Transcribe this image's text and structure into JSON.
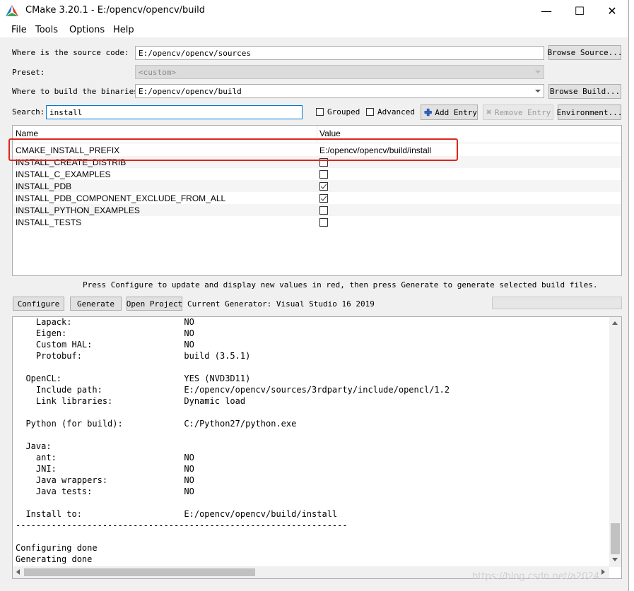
{
  "window": {
    "title": "CMake 3.20.1 - E:/opencv/opencv/build",
    "controls": {
      "minimize": "—",
      "maximize": "☐",
      "close": "✕"
    }
  },
  "menu": {
    "file": "File",
    "tools": "Tools",
    "options": "Options",
    "help": "Help"
  },
  "form": {
    "source_label": "Where is the source code:",
    "source_value": "E:/opencv/opencv/sources",
    "browse_source": "Browse Source...",
    "preset_label": "Preset:",
    "preset_value": "<custom>",
    "build_label": "Where to build the binaries:",
    "build_value": "E:/opencv/opencv/build",
    "browse_build": "Browse Build...",
    "search_label": "Search:",
    "search_value": "install",
    "grouped_label": "Grouped",
    "advanced_label": "Advanced",
    "add_entry": "Add Entry",
    "remove_entry": "Remove Entry",
    "environment": "Environment..."
  },
  "table": {
    "headers": {
      "name": "Name",
      "value": "Value"
    },
    "rows": [
      {
        "name": "CMAKE_INSTALL_PREFIX",
        "value": "E:/opencv/opencv/build/install"
      },
      {
        "name": "INSTALL_CREATE_DISTRIB",
        "checked": false
      },
      {
        "name": "INSTALL_C_EXAMPLES",
        "checked": false
      },
      {
        "name": "INSTALL_PDB",
        "checked": true
      },
      {
        "name": "INSTALL_PDB_COMPONENT_EXCLUDE_FROM_ALL",
        "checked": true
      },
      {
        "name": "INSTALL_PYTHON_EXAMPLES",
        "checked": false
      },
      {
        "name": "INSTALL_TESTS",
        "checked": false
      }
    ]
  },
  "hint": "Press Configure to update and display new values in red, then press Generate to generate selected build files.",
  "actions": {
    "configure": "Configure",
    "generate": "Generate",
    "open_project": "Open Project",
    "current_generator": "Current Generator: Visual Studio 16 2019"
  },
  "output": [
    "    Lapack:                      NO",
    "    Eigen:                       NO",
    "    Custom HAL:                  NO",
    "    Protobuf:                    build (3.5.1)",
    "",
    "  OpenCL:                        YES (NVD3D11)",
    "    Include path:                E:/opencv/opencv/sources/3rdparty/include/opencl/1.2",
    "    Link libraries:              Dynamic load",
    "",
    "  Python (for build):            C:/Python27/python.exe",
    "",
    "  Java:",
    "    ant:                         NO",
    "    JNI:                         NO",
    "    Java wrappers:               NO",
    "    Java tests:                  NO",
    "",
    "  Install to:                    E:/opencv/opencv/build/install",
    "-----------------------------------------------------------------",
    "",
    "Configuring done",
    "Generating done"
  ],
  "watermark": "https://blog.csdn.net/a2024..."
}
